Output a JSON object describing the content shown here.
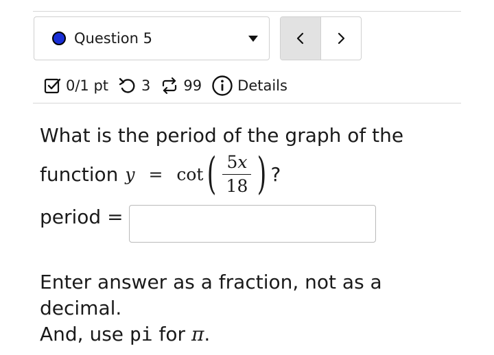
{
  "question_nav": {
    "selected_question": "Question 5",
    "status_color": "#1a2fd6"
  },
  "meta": {
    "score": "0/1 pt",
    "attempts": "3",
    "versions": "99",
    "details_label": "Details"
  },
  "question": {
    "text_line1": "What is the period of the graph of the",
    "text_line2_prefix": "function",
    "math_var": "y",
    "math_eq": "=",
    "math_func": "cot",
    "frac_numerator_coef": "5",
    "frac_numerator_var": "x",
    "frac_denominator": "18",
    "text_line2_suffix": "?",
    "answer_label": "period =",
    "answer_value": ""
  },
  "hint": {
    "line1": "Enter answer as a fraction, not as a decimal.",
    "line2_prefix": "And, use ",
    "line2_code": "pi",
    "line2_mid": " for ",
    "line2_symbol": "π",
    "line2_end": "."
  }
}
